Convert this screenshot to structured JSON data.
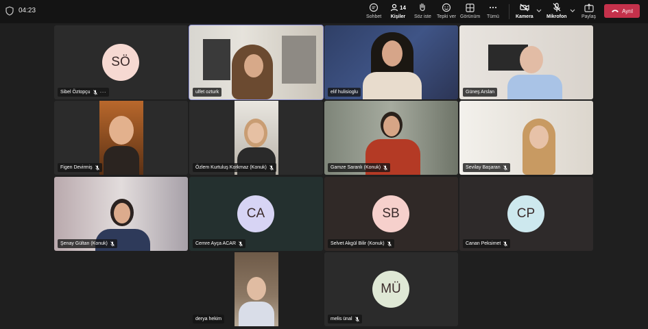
{
  "topbar": {
    "timer": "04:23",
    "buttons": {
      "chat": "Sohbet",
      "people": "Kişiler",
      "people_count": "14",
      "raise": "Söz iste",
      "react": "Tepki ver",
      "view": "Görünüm",
      "more": "Tümü",
      "camera": "Kamera",
      "mic": "Mikrofon",
      "share": "Paylaş"
    },
    "leave": "Ayrıl"
  },
  "participants": [
    {
      "name": "Sibel Öztopçu",
      "initials": "SÖ",
      "avatar_color": "#f6d9d2",
      "video": false
    },
    {
      "name": "ulfet ozturk",
      "video": true,
      "active_speaker": true
    },
    {
      "name": "elif hulisioglu",
      "video": true
    },
    {
      "name": "Güneş Arslan",
      "video": true
    },
    {
      "name": "Figen Devirmiş",
      "video": true
    },
    {
      "name": "Özlem Kurtuluş Korkmaz (Konuk)",
      "video": true
    },
    {
      "name": "Gamze Saranlı (Konuk)",
      "video": true
    },
    {
      "name": "Sevilay Başaran",
      "video": true
    },
    {
      "name": "Şenay Gültan (Konuk)",
      "video": true
    },
    {
      "name": "Cemre Ayça ACAR",
      "initials": "CA",
      "avatar_color": "#d7d4f4",
      "video": false
    },
    {
      "name": "Selvet Akgül Bilir (Konuk)",
      "initials": "SB",
      "avatar_color": "#f6d0cc",
      "video": false
    },
    {
      "name": "Canan Peksimet",
      "initials": "CP",
      "avatar_color": "#cde8ee",
      "video": false
    },
    {
      "name": "derya hekim",
      "video": true
    },
    {
      "name": "melis ünal",
      "initials": "MÜ",
      "avatar_color": "#dfe8d5",
      "video": false
    }
  ],
  "colors": {
    "leave_button": "#c4314b",
    "active_outline": "#8b8fd6",
    "tile_bg": "#2b2b2b"
  }
}
